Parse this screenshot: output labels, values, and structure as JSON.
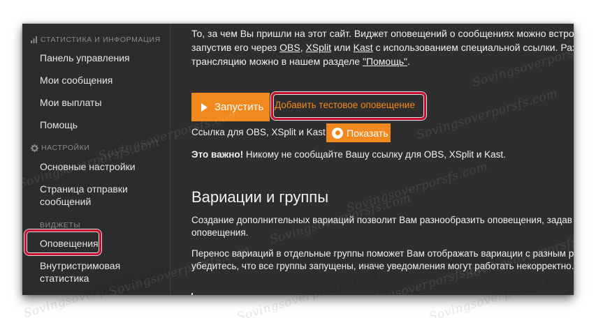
{
  "sidebar": {
    "sections": [
      {
        "title": "СТАТИСТИКА И ИНФОРМАЦИЯ",
        "icon": "bar-chart-icon",
        "items": [
          "Панель управления",
          "Мои сообщения",
          "Мои выплаты",
          "Помощь"
        ]
      },
      {
        "title": "НАСТРОЙКИ",
        "icon": "gear-icon",
        "items": [
          "Основные настройки",
          "Страница отправки сообщений"
        ]
      },
      {
        "title": "ВИДЖЕТЫ",
        "icon": "",
        "items": [
          "Оповещения",
          "Внутристримовая статистика"
        ]
      }
    ]
  },
  "main": {
    "intro": {
      "line1": "То, за чем Вы пришли на этот сайт. Виджет оповещений о сообщениях можно встроить",
      "line2_prefix": "запустив его через ",
      "obs": "OBS",
      "sep1": ", ",
      "xsplit": "XSplit",
      "sep2": " или ",
      "kast": "Kast",
      "line2_suffix": " с использованием специальной ссылки. Различ",
      "line3_prefix": "трансляцию можно в нашем разделе ",
      "help_link": "\"Помощь\"",
      "line3_suffix": "."
    },
    "launch_button": "Запустить",
    "test_alert_button": "Добавить тестовое оповещение",
    "link_label": "Ссылка для OBS, XSplit и Kast:",
    "show_button": "Показать",
    "important_bold": "Это важно!",
    "important_text": " Никому не сообщайте Вашу ссылку для OBS, XSplit и Kast.",
    "variations_heading": "Вариации и группы",
    "var_p1_line1": "Создание дополнительных вариаций позволит Вам разнообразить оповещения, задав",
    "var_p1_line2": "оповещения.",
    "var_p2_line1": "Перенос вариаций в отдельные группы поможет Вам отображать вариации с разным р",
    "var_p2_line2": "убедитесь, что все группы запущены, иначе уведомления могут работать некорректно."
  },
  "watermark": "Sovingsoverporsfs.com",
  "colors": {
    "accent": "#f2891e",
    "highlight": "#c8102e",
    "sidebar_bg": "#2c2c2c",
    "main_bg": "#2e2e2e"
  }
}
